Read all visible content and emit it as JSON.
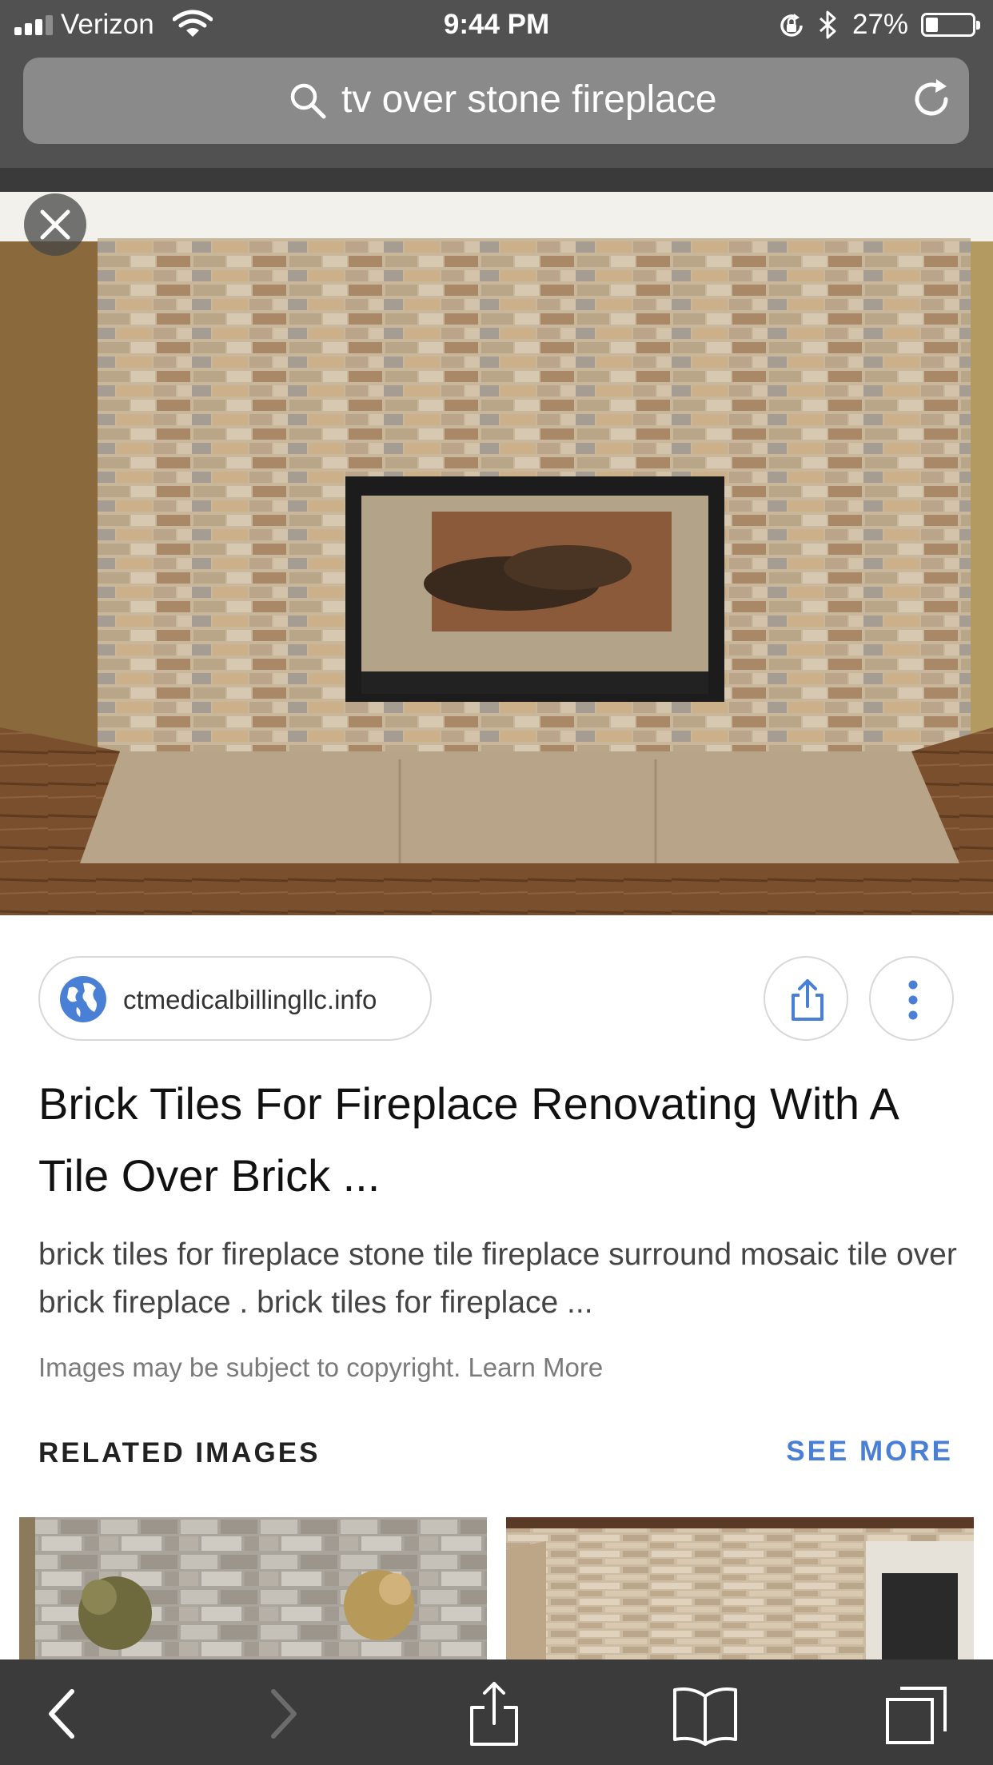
{
  "status_bar": {
    "carrier": "Verizon",
    "time": "9:44 PM",
    "battery_percent": "27%",
    "battery_level": 0.27,
    "signal_bars_filled": 3,
    "signal_bars_total": 4
  },
  "url_bar": {
    "query": "tv over stone fireplace",
    "icons": [
      "search-icon",
      "reload-icon"
    ]
  },
  "hero": {
    "close_icon": "close-icon"
  },
  "result": {
    "source": "ctmedicalbillingllc.info",
    "title": "Brick Tiles For Fireplace Renovating With A Tile Over Brick ...",
    "description": "brick tiles for fireplace stone tile fireplace surround mosaic tile over brick fireplace . brick tiles for fireplace ...",
    "copyright_notice": "Images may be subject to copyright.",
    "learn_more": "Learn More"
  },
  "related": {
    "heading": "RELATED IMAGES",
    "see_more": "SEE MORE"
  },
  "toolbar": {
    "items": [
      "back-icon",
      "forward-icon",
      "share-icon",
      "bookmarks-icon",
      "tabs-icon"
    ]
  },
  "colors": {
    "chrome_gray": "#515151",
    "url_bar": "#8a8a8a",
    "toolbar": "#3b3b3b",
    "accent_blue": "#4a7fd6"
  }
}
